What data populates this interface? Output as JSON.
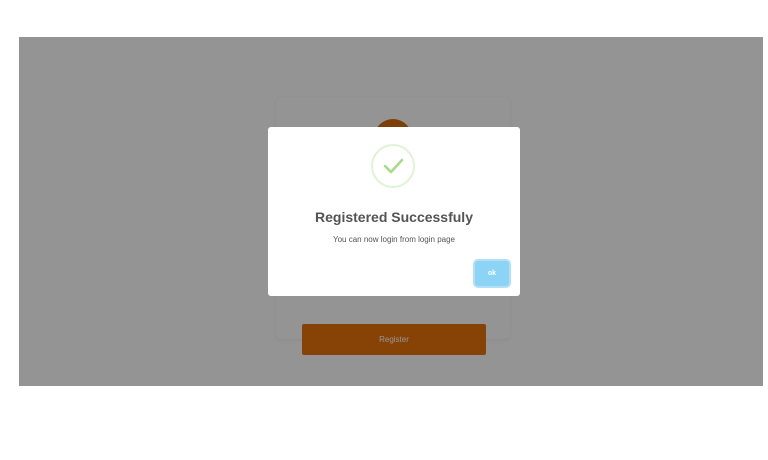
{
  "background": {
    "register_button_label": "Register",
    "avatar_color": "#d96c0e",
    "accent_color": "#e8740a"
  },
  "modal": {
    "icon": "success-check-icon",
    "title": "Registered Successfuly",
    "message": "You can now login from login page",
    "ok_label": "ok",
    "ok_color": "#8cd4f5",
    "check_color": "#a5dc86"
  }
}
